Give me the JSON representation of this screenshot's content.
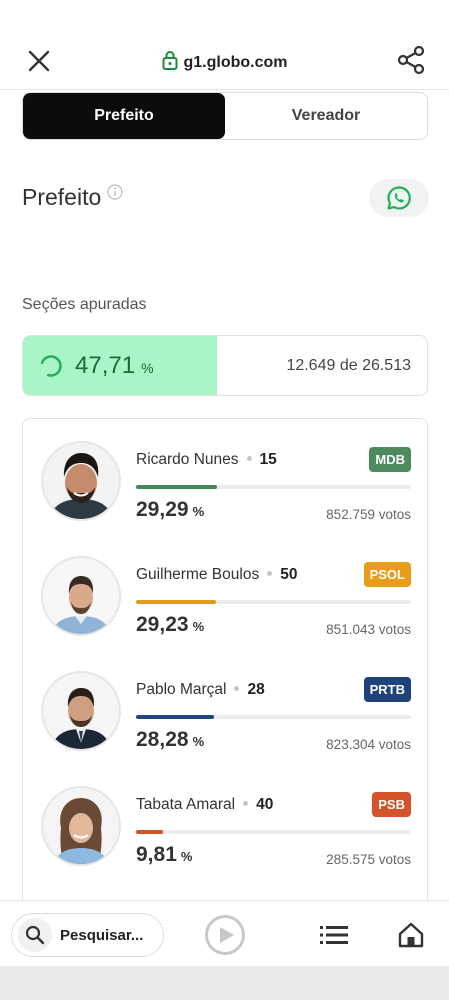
{
  "browser": {
    "url": "g1.globo.com"
  },
  "tabs": [
    {
      "label": "Prefeito",
      "active": true
    },
    {
      "label": "Vereador",
      "active": false
    }
  ],
  "section": {
    "title": "Prefeito"
  },
  "apuracao": {
    "label": "Seções apuradas",
    "percent": "47,71",
    "percent_sign": "%",
    "sections_text": "12.649 de 26.513"
  },
  "candidates": [
    {
      "name": "Ricardo Nunes",
      "number": "15",
      "party": "MDB",
      "party_color": "#4d8b5e",
      "bar_color": "#3f8a55",
      "percent": "29,29",
      "percent_sign": "%",
      "votes": "852.759 votos",
      "share": 0.2929
    },
    {
      "name": "Guilherme Boulos",
      "number": "50",
      "party": "PSOL",
      "party_color": "#e89d1a",
      "bar_color": "#e09a22",
      "percent": "29,23",
      "percent_sign": "%",
      "votes": "851.043 votos",
      "share": 0.2923
    },
    {
      "name": "Pablo Marçal",
      "number": "28",
      "party": "PRTB",
      "party_color": "#20427a",
      "bar_color": "#22467e",
      "percent": "28,28",
      "percent_sign": "%",
      "votes": "823.304 votos",
      "share": 0.2828
    },
    {
      "name": "Tabata Amaral",
      "number": "40",
      "party": "PSB",
      "party_color": "#d3542a",
      "bar_color": "#d3542a",
      "percent": "9,81",
      "percent_sign": "%",
      "votes": "285.575 votos",
      "share": 0.0981
    }
  ],
  "bottom_nav": {
    "search_label": "Pesquisar..."
  },
  "colors": {
    "progress_bg": "#a9f5c8",
    "progress_text": "#1a6b3a",
    "whatsapp": "#1fae53"
  }
}
